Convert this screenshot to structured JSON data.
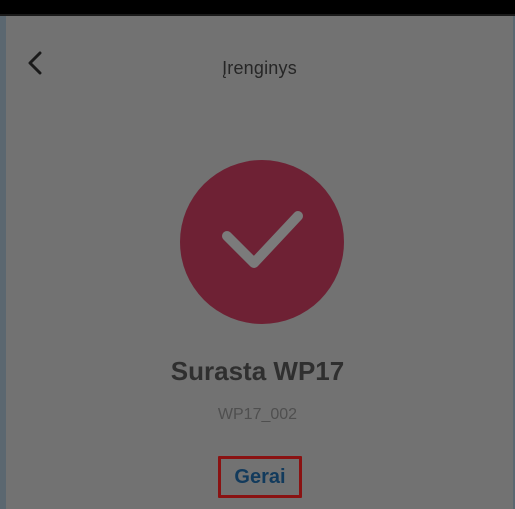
{
  "status_bar": {
    "color": "#000000"
  },
  "header": {
    "title": "Įrenginys",
    "back_icon": "chevron-left-icon"
  },
  "success": {
    "icon": "checkmark-icon",
    "circle_color": "#6e2134",
    "check_color": "#7a7a7a"
  },
  "device": {
    "name": "Surasta WP17",
    "id": "WP17_002"
  },
  "actions": {
    "done_label": "Gerai",
    "done_color": "#123a5c",
    "highlight_color": "#8a1212"
  }
}
